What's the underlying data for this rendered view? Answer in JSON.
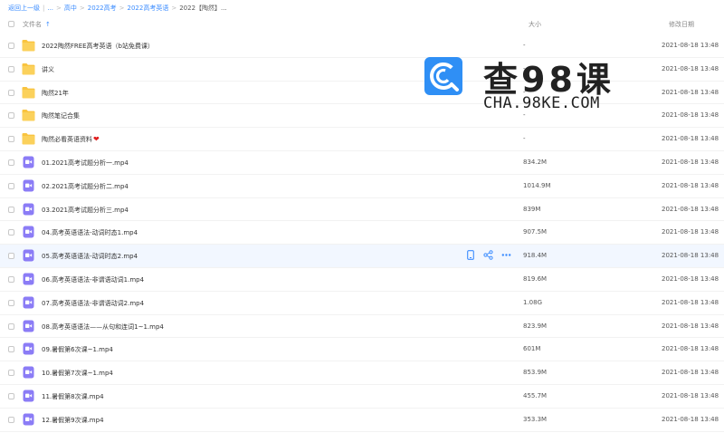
{
  "breadcrumb": {
    "items": [
      "返回上一级",
      "...",
      "高中",
      "2022高考",
      "2022高考英语",
      "2022【陶然】..."
    ]
  },
  "header": {
    "name_label": "文件名",
    "sort_icon": "arrow-up-icon",
    "size_label": "大小",
    "date_label": "修改日期"
  },
  "files": [
    {
      "type": "folder",
      "name": "2022陶然FREE高考英语（b站免费课）",
      "size": "-",
      "date": "2021-08-18 13:48"
    },
    {
      "type": "folder",
      "name": "讲义",
      "size": "-",
      "date": "2021-08-18 13:48"
    },
    {
      "type": "folder",
      "name": "陶然21年",
      "size": "-",
      "date": "2021-08-18 13:48"
    },
    {
      "type": "folder",
      "name": "陶然笔记合集",
      "size": "-",
      "date": "2021-08-18 13:48"
    },
    {
      "type": "folder",
      "name": "陶然必看英语资料",
      "heart": "❤",
      "size": "-",
      "date": "2021-08-18 13:48"
    },
    {
      "type": "video",
      "name": "01.2021高考试题分析一.mp4",
      "size": "834.2M",
      "date": "2021-08-18 13:48"
    },
    {
      "type": "video",
      "name": "02.2021高考试题分析二.mp4",
      "size": "1014.9M",
      "date": "2021-08-18 13:48"
    },
    {
      "type": "video",
      "name": "03.2021高考试题分析三.mp4",
      "size": "839M",
      "date": "2021-08-18 13:48"
    },
    {
      "type": "video",
      "name": "04.高考英语语法-动词时态1.mp4",
      "size": "907.5M",
      "date": "2021-08-18 13:48"
    },
    {
      "type": "video",
      "name": "05.高考英语语法-动词时态2.mp4",
      "size": "918.4M",
      "date": "2021-08-18 13:48",
      "hover": true
    },
    {
      "type": "video",
      "name": "06.高考英语语法-非谓语动词1.mp4",
      "size": "819.6M",
      "date": "2021-08-18 13:48"
    },
    {
      "type": "video",
      "name": "07.高考英语语法-非谓语动词2.mp4",
      "size": "1.08G",
      "date": "2021-08-18 13:48"
    },
    {
      "type": "video",
      "name": "08.高考英语语法——从句和连词1~1.mp4",
      "size": "823.9M",
      "date": "2021-08-18 13:48"
    },
    {
      "type": "video",
      "name": "09.暑假第6次课~1.mp4",
      "size": "601M",
      "date": "2021-08-18 13:48"
    },
    {
      "type": "video",
      "name": "10.暑假第7次课~1.mp4",
      "size": "853.9M",
      "date": "2021-08-18 13:48"
    },
    {
      "type": "video",
      "name": "11.暑假第8次课.mp4",
      "size": "455.7M",
      "date": "2021-08-18 13:48"
    },
    {
      "type": "video",
      "name": "12.暑假第9次课.mp4",
      "size": "353.3M",
      "date": "2021-08-18 13:48"
    }
  ],
  "row_actions": [
    "phone-icon",
    "share-icon",
    "more-icon"
  ],
  "watermark": {
    "text_cn": "查98课",
    "text_en": "CHA.98KE.COM"
  },
  "colors": {
    "accent": "#3b8cff",
    "folder": "#f9c440",
    "video": "#8b7cf6",
    "hover_row": "#f2f7ff",
    "watermark_logo": "#2f8ff5"
  }
}
